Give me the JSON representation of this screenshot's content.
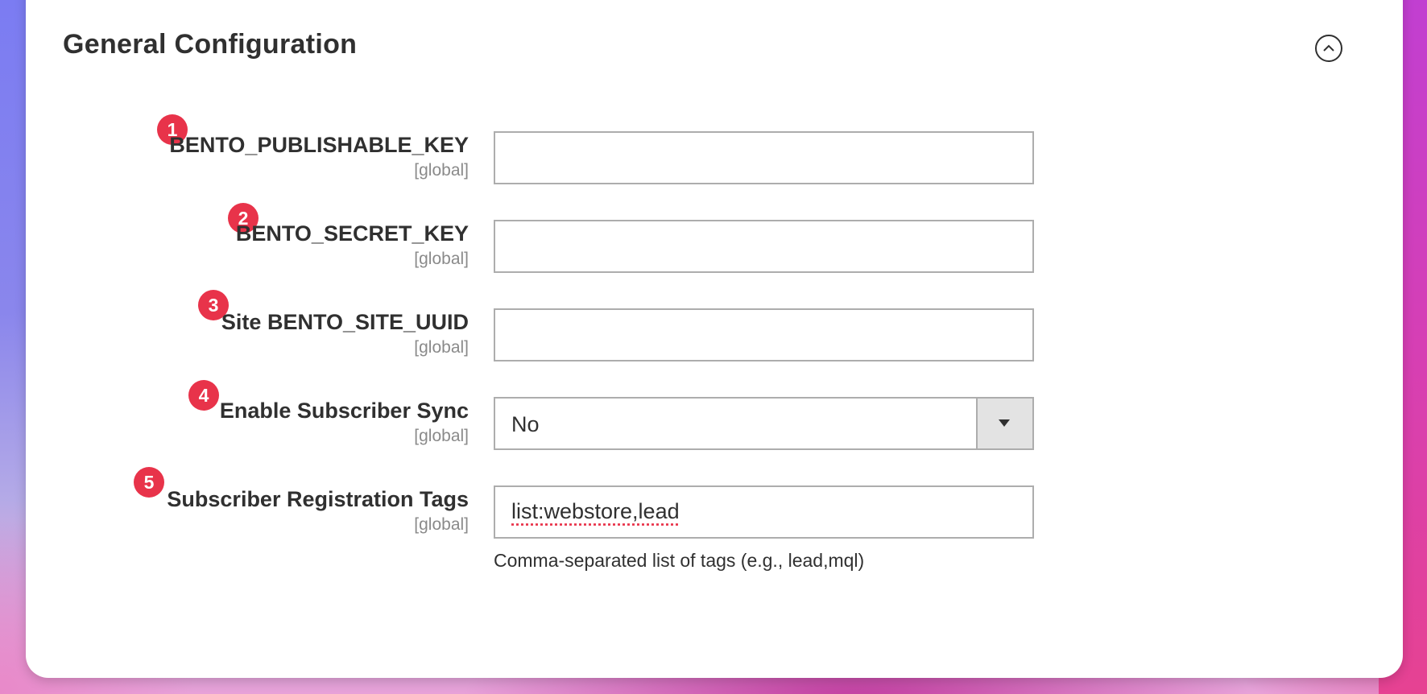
{
  "section": {
    "title": "General Configuration"
  },
  "fields": [
    {
      "badge": "1",
      "label": "BENTO_PUBLISHABLE_KEY",
      "scope": "[global]",
      "value": ""
    },
    {
      "badge": "2",
      "label": "BENTO_SECRET_KEY",
      "scope": "[global]",
      "value": ""
    },
    {
      "badge": "3",
      "label": "Site BENTO_SITE_UUID",
      "scope": "[global]",
      "value": ""
    },
    {
      "badge": "4",
      "label": "Enable Subscriber Sync",
      "scope": "[global]",
      "value": "No"
    },
    {
      "badge": "5",
      "label": "Subscriber Registration Tags",
      "scope": "[global]",
      "value": "list:webstore,lead",
      "note": "Comma-separated list of tags (e.g., lead,mql)"
    }
  ],
  "icons": {
    "collapse": "chevron-up-circle-icon",
    "dropdown": "caret-down-icon"
  },
  "colors": {
    "badge": "#e8334a",
    "text": "#303030",
    "scope": "#8a8a8a",
    "input_border": "#adadad"
  }
}
